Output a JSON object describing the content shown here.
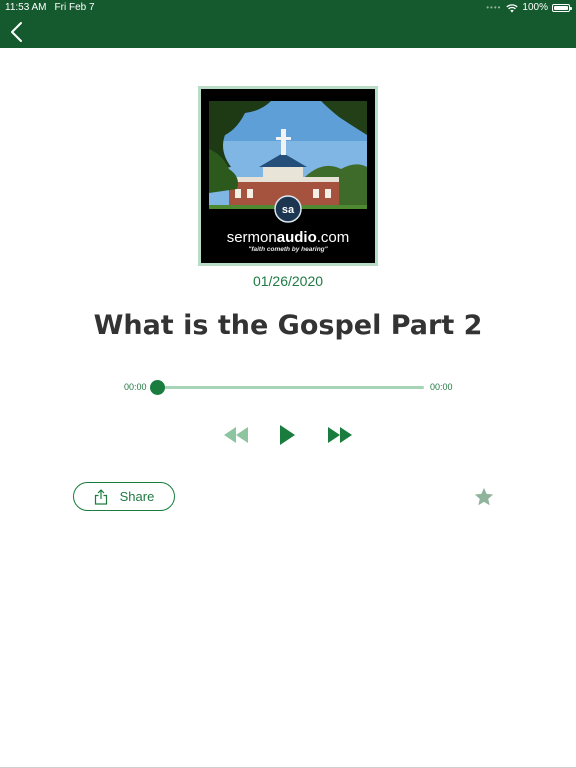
{
  "status_bar": {
    "time": "11:53 AM",
    "date": "Fri Feb 7",
    "battery": "100%"
  },
  "nav": {
    "back_icon": "chevron-left-icon"
  },
  "artwork": {
    "brand_regular": "sermon",
    "brand_bold": "audio",
    "brand_suffix": ".com",
    "badge": "sa",
    "tagline": "\"faith cometh by hearing\""
  },
  "sermon": {
    "date": "01/26/2020",
    "title": "What is the Gospel Part 2"
  },
  "player": {
    "current_time": "00:00",
    "duration": "00:00",
    "progress": 0,
    "rewind_icon": "rewind-icon",
    "play_icon": "play-icon",
    "forward_icon": "fast-forward-icon"
  },
  "actions": {
    "share_label": "Share",
    "share_icon": "share-icon",
    "favorite_icon": "star-icon"
  },
  "colors": {
    "nav_bar": "#155a2e",
    "accent": "#1a7d3e",
    "accent_light": "#a7d3b6",
    "title_text": "#333333",
    "star": "#8fb39b"
  }
}
